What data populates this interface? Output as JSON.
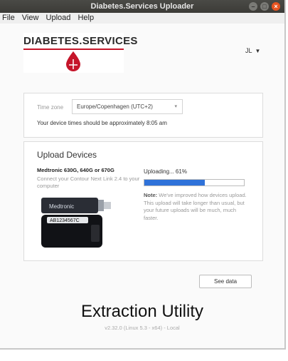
{
  "window": {
    "title": "Diabetes.Services Uploader",
    "close_glyph": "×",
    "min_glyph": "–",
    "max_glyph": "□"
  },
  "menu": {
    "items": [
      "File",
      "View",
      "Upload",
      "Help"
    ]
  },
  "logo": {
    "text": "DIABETES.SERVICES",
    "brand_color": "#c5152a"
  },
  "user": {
    "initials": "JL",
    "caret": "▼"
  },
  "timezone": {
    "label": "Time zone",
    "selected": "Europe/Copenhagen (UTC+2)",
    "caret": "▾",
    "message": "Your device times should be approximately 8:05 am"
  },
  "upload": {
    "title": "Upload Devices",
    "device_name": "Medtronic 630G, 640G or 670G",
    "instructions": "Connect your Contour Next Link 2.4 to your computer",
    "device_brand_text": "Medtronic",
    "device_serial_text": "AB1234567C",
    "status": "Uploading... 61%",
    "progress": 0.61,
    "accent": "#2f72d9",
    "note_label": "Note:",
    "note_text": " We've improved how devices upload. This upload will take longer than usual, but your future uploads will be much, much faster."
  },
  "actions": {
    "see_data": "See data"
  },
  "overlay_text": "Extraction Utility",
  "version": "v2.32.0 (Linux 5.3 - x64) - Local"
}
